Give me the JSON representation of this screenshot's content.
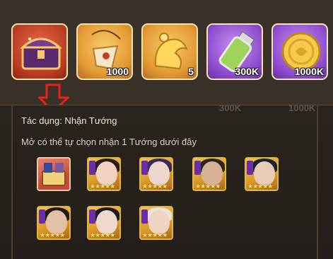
{
  "rewards": [
    {
      "name": "mystery-chest",
      "qty": "",
      "bg": "red"
    },
    {
      "name": "scroll-pendant",
      "qty": "1000",
      "bg": "gold"
    },
    {
      "name": "golden-dragon",
      "qty": "5",
      "bg": "gold"
    },
    {
      "name": "potion-bottle",
      "qty": "300K",
      "bg": "purple"
    },
    {
      "name": "gold-coin",
      "qty": "1000K",
      "bg": "purple"
    }
  ],
  "panel": {
    "effect_label": "Tác dụng: Nhận Tướng",
    "description": "Mở có thể tự chọn nhận 1 Tướng dưới đây",
    "faded_top": [
      "300K",
      "1000K"
    ]
  },
  "heroes": [
    {
      "name": "hero-chest",
      "stars": "",
      "theme": "red"
    },
    {
      "name": "hero-1",
      "stars": "★★★★★",
      "theme": "gold"
    },
    {
      "name": "hero-2",
      "stars": "★★★★★",
      "theme": "gold"
    },
    {
      "name": "hero-3",
      "stars": "★★★★★",
      "theme": "gold"
    },
    {
      "name": "hero-4",
      "stars": "★★★★★",
      "theme": "gold"
    },
    {
      "name": "hero-5",
      "stars": "★★★★★",
      "theme": "gold"
    },
    {
      "name": "hero-6",
      "stars": "★★★★★",
      "theme": "gold"
    },
    {
      "name": "hero-7",
      "stars": "★★★★★",
      "theme": "gold"
    }
  ],
  "colors": {
    "arrow": "#e8221b",
    "gold_border": "#e1b341",
    "purple_tag": "#6a2fa8"
  }
}
